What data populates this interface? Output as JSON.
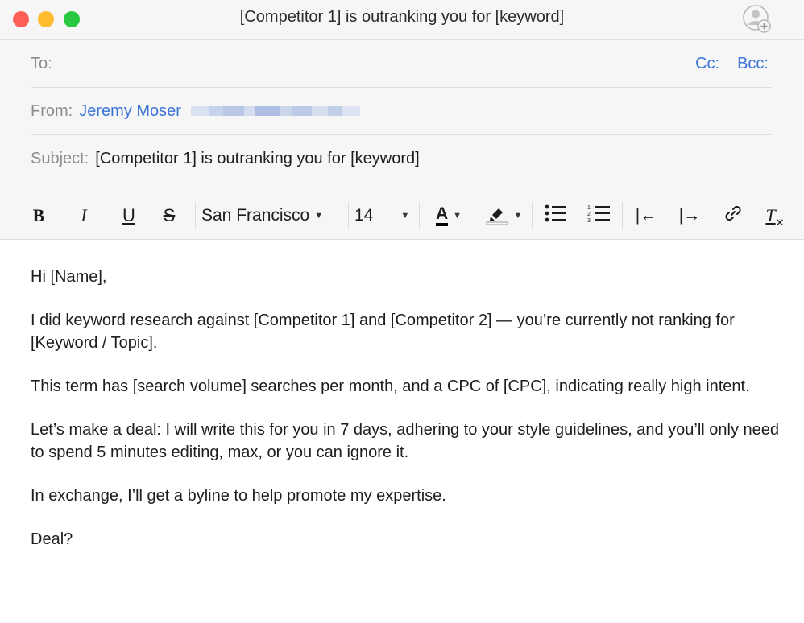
{
  "window": {
    "title": "[Competitor 1] is outranking you for [keyword]",
    "icons": [
      "close-button",
      "minimize-button",
      "zoom-button",
      "add-contact-icon"
    ]
  },
  "header": {
    "to_label": "To:",
    "cc_label": "Cc:",
    "bcc_label": "Bcc:",
    "from_label": "From:",
    "from_name": "Jeremy Moser",
    "subject_label": "Subject:",
    "subject_value": "[Competitor 1] is outranking you for [keyword]"
  },
  "toolbar": {
    "bold": "B",
    "italic": "I",
    "underline": "U",
    "strikethrough": "S",
    "font_family": "San Francisco",
    "font_size": "14",
    "text_color": "A",
    "text_color_value": "#000000",
    "icons": [
      "highlight-icon",
      "bullet-list-icon",
      "numbered-list-icon",
      "outdent-icon",
      "indent-icon",
      "link-icon",
      "clear-formatting-icon"
    ],
    "outdent": "|←",
    "indent": "|→",
    "clear_format": "T"
  },
  "body": {
    "greeting": "Hi [Name],",
    "p1": "I did keyword research against [Competitor 1] and [Competitor 2] — you’re currently not ranking for [Keyword / Topic].",
    "p2": "This term has [search volume] searches per month, and a CPC of [CPC], indicating really high intent.",
    "p3": "Let’s make a deal: I will write this for you in 7 days, adhering to your style guidelines, and you’ll only need to spend 5 minutes editing, max, or you can ignore it.",
    "p4": "In exchange, I’ll get a byline to help promote my expertise.",
    "closing": "Deal?"
  },
  "colors": {
    "accent": "#3b74d8",
    "close": "#fe5f57",
    "minimize": "#febc2e",
    "zoom": "#28c840"
  }
}
